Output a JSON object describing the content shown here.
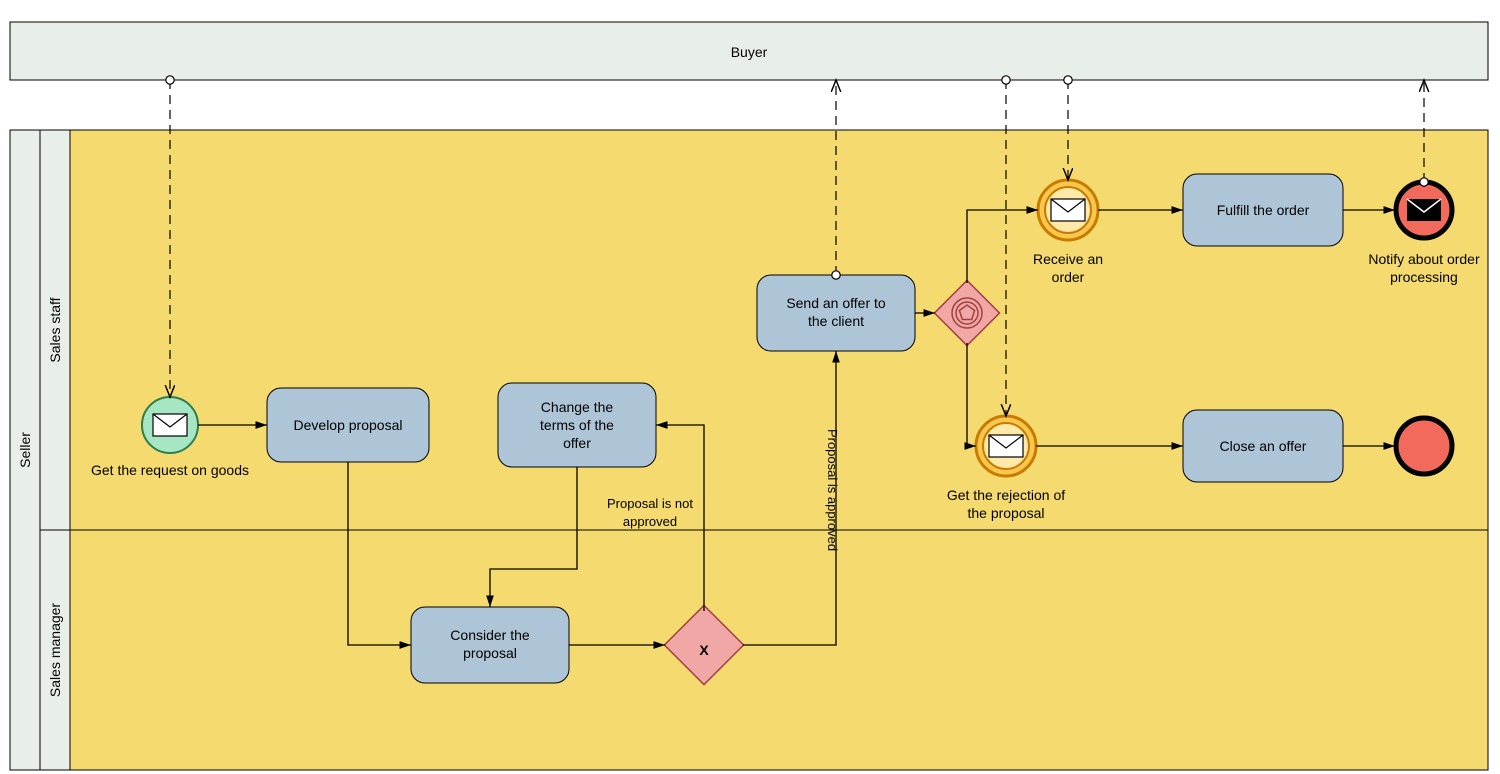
{
  "pools": {
    "buyer": "Buyer",
    "seller": "Seller",
    "salesStaff": "Sales staff",
    "salesManager": "Sales manager"
  },
  "tasks": {
    "develop": "Develop proposal",
    "change": "Change the terms of the offer",
    "consider": "Consider the proposal",
    "send": "Send an offer to the client",
    "fulfill": "Fulfill the order",
    "close": "Close an offer"
  },
  "events": {
    "getReq": "Get the request on goods",
    "receive": "Receive an order",
    "reject": "Get the rejection of the proposal",
    "notify": "Notify about order processing"
  },
  "flows": {
    "notApproved": "Proposal is not approved",
    "approved": "Proposal is approved"
  }
}
